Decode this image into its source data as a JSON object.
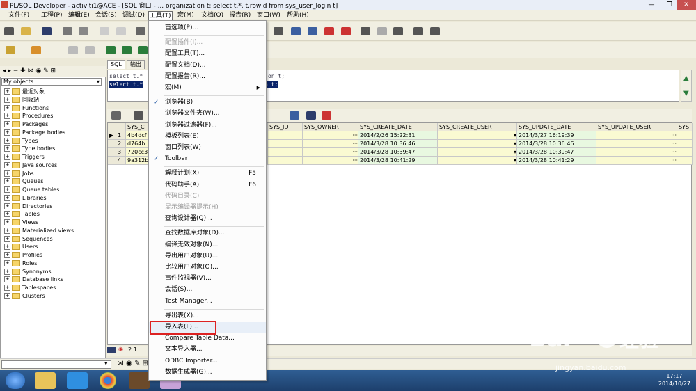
{
  "window": {
    "title": "PL/SQL Developer - activiti1@ACE - [SQL 窗口 - ... organization t; select t.*, t.rowid from sys_user_login t]",
    "min": "—",
    "max": "❐",
    "close": "✕"
  },
  "menubar": [
    {
      "label": "文件(F)"
    },
    {
      "label": "工程(P)"
    },
    {
      "label": "编辑(E)"
    },
    {
      "label": "会话(S)"
    },
    {
      "label": "调试(D)"
    },
    {
      "label": "工具(T)"
    },
    {
      "label": "宏(M)"
    },
    {
      "label": "文档(O)"
    },
    {
      "label": "报告(R)"
    },
    {
      "label": "窗口(W)"
    },
    {
      "label": "帮助(H)"
    }
  ],
  "left_panel": {
    "selector": "My objects",
    "tree": [
      "最近对象",
      "回收站",
      "Functions",
      "Procedures",
      "Packages",
      "Package bodies",
      "Types",
      "Type bodies",
      "Triggers",
      "Java sources",
      "Jobs",
      "Queues",
      "Queue tables",
      "Libraries",
      "Directories",
      "Tables",
      "Views",
      "Materialized views",
      "Sequences",
      "Users",
      "Profiles",
      "Roles",
      "Synonyms",
      "Database links",
      "Tablespaces",
      "Clusters"
    ]
  },
  "editor": {
    "tabs": [
      "SQL",
      "输出"
    ],
    "line1": "select t.*",
    "line1_tail": "on t;",
    "line2": "select t.*",
    "line2_tail": "n t;"
  },
  "grid": {
    "columns": [
      "SYS_ID",
      "SYS_OWNER",
      "SYS_CREATE_DATE",
      "SYS_CREATE_USER",
      "SYS_UPDATE_DATE",
      "SYS_UPDATE_USER",
      "SYS"
    ],
    "first_col_header": "SYS_C",
    "rows": [
      {
        "n": "1",
        "id": "4b4dcf",
        "create": "2014/2/26 15:22:31",
        "update": "2014/3/27 16:19:39"
      },
      {
        "n": "2",
        "id": "d764b",
        "create": "2014/3/28 10:36:46",
        "update": "2014/3/28 10:36:46"
      },
      {
        "n": "3",
        "id": "720cc3",
        "create": "2014/3/28 10:39:47",
        "update": "2014/3/28 10:39:47"
      },
      {
        "n": "4",
        "id": "9a312b",
        "create": "2014/3/28 10:41:29",
        "update": "2014/3/28 10:41:29"
      }
    ]
  },
  "status": {
    "position": "2:1"
  },
  "tools_menu": {
    "items": [
      {
        "label": "首选项(P)...",
        "disabled": false
      },
      {
        "sep": true
      },
      {
        "label": "配置插件(I)...",
        "disabled": true
      },
      {
        "label": "配置工具(T)...",
        "disabled": false
      },
      {
        "label": "配置文档(D)...",
        "disabled": false
      },
      {
        "label": "配置报告(R)...",
        "disabled": false
      },
      {
        "label": "宏(M)",
        "disabled": false,
        "submenu": true
      },
      {
        "sep": true
      },
      {
        "label": "浏览器(B)",
        "disabled": false,
        "checked": true
      },
      {
        "label": "浏览器文件夹(W)...",
        "disabled": false
      },
      {
        "label": "浏览器过滤器(F)...",
        "disabled": false
      },
      {
        "label": "模板列表(E)",
        "disabled": false
      },
      {
        "label": "窗口列表(W)",
        "disabled": false
      },
      {
        "label": "Toolbar",
        "disabled": false,
        "checked": true
      },
      {
        "sep": true
      },
      {
        "label": "解释计划(X)",
        "disabled": false,
        "shortcut": "F5"
      },
      {
        "label": "代码助手(A)",
        "disabled": false,
        "shortcut": "F6"
      },
      {
        "label": "代码目录(C)",
        "disabled": true
      },
      {
        "label": "显示编译器提示(H)",
        "disabled": true
      },
      {
        "label": "查询设计器(Q)...",
        "disabled": false
      },
      {
        "sep": true
      },
      {
        "label": "查找数据库对象(D)...",
        "disabled": false
      },
      {
        "label": "编译无效对象(N)...",
        "disabled": false
      },
      {
        "label": "导出用户对象(U)...",
        "disabled": false
      },
      {
        "label": "比较用户对象(O)...",
        "disabled": false
      },
      {
        "label": "事件监视器(V)...",
        "disabled": false
      },
      {
        "label": "会话(S)...",
        "disabled": false
      },
      {
        "label": "Test Manager...",
        "disabled": false
      },
      {
        "sep": true
      },
      {
        "label": "导出表(X)...",
        "disabled": false
      },
      {
        "label": "导入表(L)...",
        "disabled": false,
        "highlight": true
      },
      {
        "label": "Compare Table Data...",
        "disabled": false
      },
      {
        "label": "文本导入器...",
        "disabled": false
      },
      {
        "label": "ODBC Importer...",
        "disabled": false
      },
      {
        "label": "数据生成器(G)...",
        "disabled": false
      }
    ]
  },
  "clock": {
    "time": "17:17",
    "date": "2014/10/27"
  },
  "watermark": {
    "text": "Bai 经验",
    "sub": "jingyan.baidu.com"
  }
}
